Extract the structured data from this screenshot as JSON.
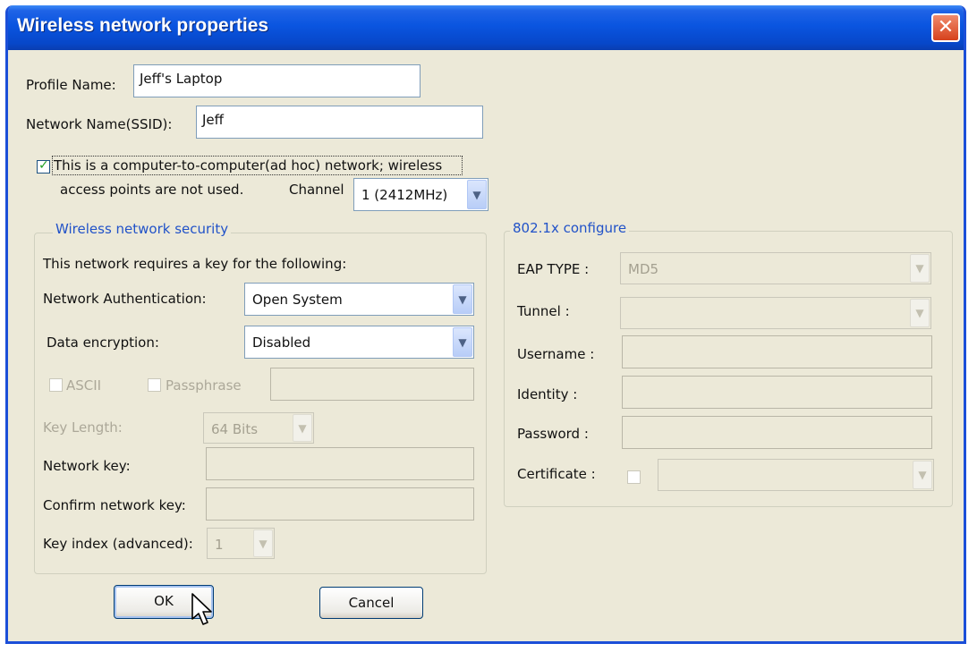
{
  "window": {
    "title": "Wireless network properties",
    "close_glyph": "✕"
  },
  "profile": {
    "label": "Profile Name:",
    "value": "Jeff's Laptop"
  },
  "ssid": {
    "label": "Network Name(SSID):",
    "value": "Jeff"
  },
  "adhoc": {
    "checked": true,
    "line1": "This is a computer-to-computer(ad hoc) network; wireless",
    "line2": "access points are not used.",
    "channel_label": "Channel",
    "channel_value": "1  (2412MHz)"
  },
  "security": {
    "group_title": "Wireless network security",
    "intro": "This network requires a key for the following:",
    "auth_label": "Network Authentication:",
    "auth_value": "Open System",
    "enc_label": "Data encryption:",
    "enc_value": "Disabled",
    "ascii_label": "ASCII",
    "passphrase_label": "Passphrase",
    "key_length_label": "Key Length:",
    "key_length_value": "64 Bits",
    "network_key_label": "Network key:",
    "confirm_key_label": "Confirm network key:",
    "key_index_label": "Key index (advanced):",
    "key_index_value": "1"
  },
  "dot1x": {
    "group_title": "802.1x configure",
    "eap_label": "EAP TYPE :",
    "eap_value": "MD5",
    "tunnel_label": "Tunnel :",
    "username_label": "Username :",
    "identity_label": "Identity :",
    "password_label": "Password :",
    "certificate_label": "Certificate :"
  },
  "buttons": {
    "ok": "OK",
    "cancel": "Cancel"
  },
  "icons": {
    "dropdown_arrow": "chevron-down-icon",
    "checkmark": "checkmark-icon",
    "cursor": "mouse-pointer-icon"
  }
}
